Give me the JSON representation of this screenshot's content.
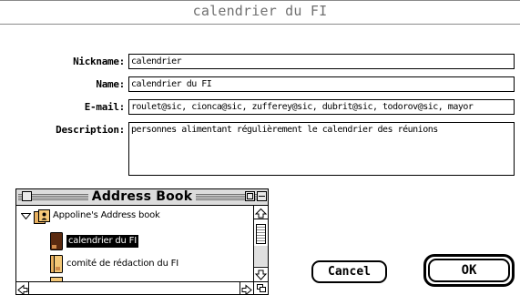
{
  "window": {
    "title": "calendrier du FI"
  },
  "form": {
    "nickname_label": "Nickname:",
    "nickname_value": "calendrier",
    "name_label": "Name:",
    "name_value": "calendrier du FI",
    "email_label": "E-mail:",
    "email_value": "roulet@sic, cionca@sic, zufferey@sic, dubrit@sic, todorov@sic, mayor",
    "description_label": "Description:",
    "description_value": "personnes alimentant régulièrement le calendrier des réunions"
  },
  "address_book": {
    "title": "Address Book",
    "items": [
      {
        "label": "Appoline's Address book",
        "icon": "address-book-icon",
        "expanded": true
      },
      {
        "label": "calendrier du FI",
        "icon": "group-card-icon",
        "selected": true
      },
      {
        "label": "comité de rédaction du FI",
        "icon": "group-card-icon",
        "selected": false
      }
    ]
  },
  "buttons": {
    "cancel": "Cancel",
    "ok": "OK"
  },
  "colors": {
    "selection_bg": "#000000",
    "book_icon": "#e8b060",
    "selected_card": "#5a2a10"
  }
}
